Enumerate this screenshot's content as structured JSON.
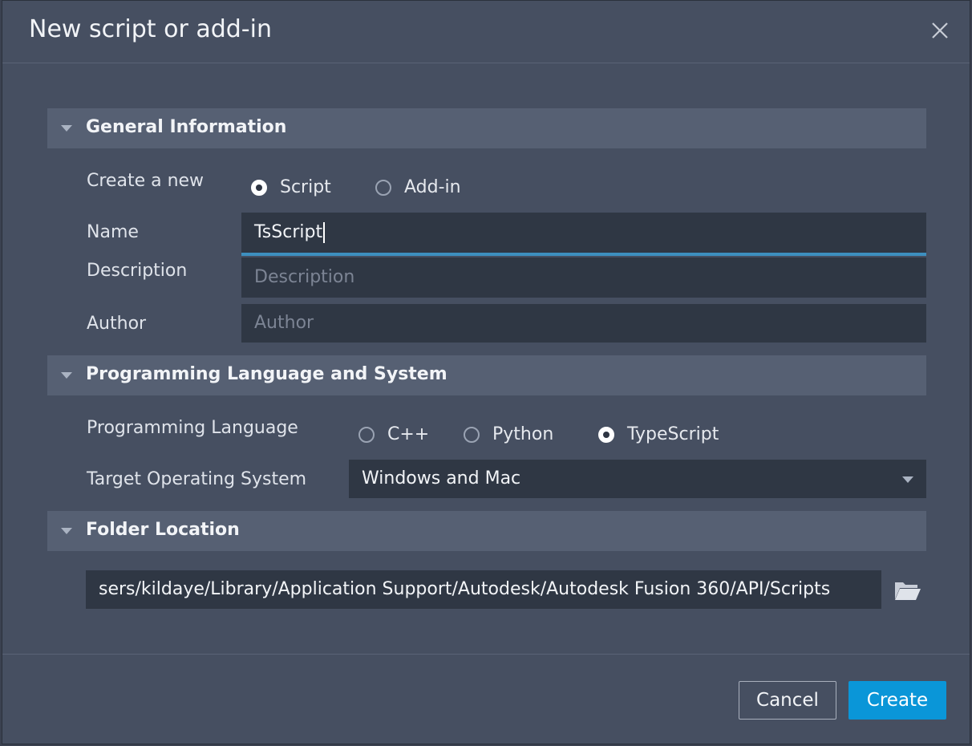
{
  "dialog": {
    "title": "New script or add-in",
    "close_icon": "close-icon"
  },
  "general": {
    "header": "General Information",
    "create_label": "Create a new",
    "type_options": [
      {
        "label": "Script",
        "selected": true
      },
      {
        "label": "Add-in",
        "selected": false
      }
    ],
    "name_label": "Name",
    "name_value": "TsScript",
    "description_label": "Description",
    "description_placeholder": "Description",
    "author_label": "Author",
    "author_placeholder": "Author"
  },
  "language": {
    "header": "Programming Language and System",
    "lang_label": "Programming Language",
    "lang_options": [
      {
        "label": "C++",
        "selected": false
      },
      {
        "label": "Python",
        "selected": false
      },
      {
        "label": "TypeScript",
        "selected": true
      }
    ],
    "os_label": "Target Operating System",
    "os_value": "Windows and Mac"
  },
  "folder": {
    "header": "Folder Location",
    "path": "sers/kildaye/Library/Application Support/Autodesk/Autodesk Fusion 360/API/Scripts",
    "browse_icon": "folder-open-icon"
  },
  "footer": {
    "cancel_label": "Cancel",
    "create_label": "Create"
  },
  "colors": {
    "dialog_bg": "#464f61",
    "section_bg": "#566073",
    "field_bg": "#2f3744",
    "accent": "#0a96d8",
    "focus_line": "#3d8fbf"
  }
}
